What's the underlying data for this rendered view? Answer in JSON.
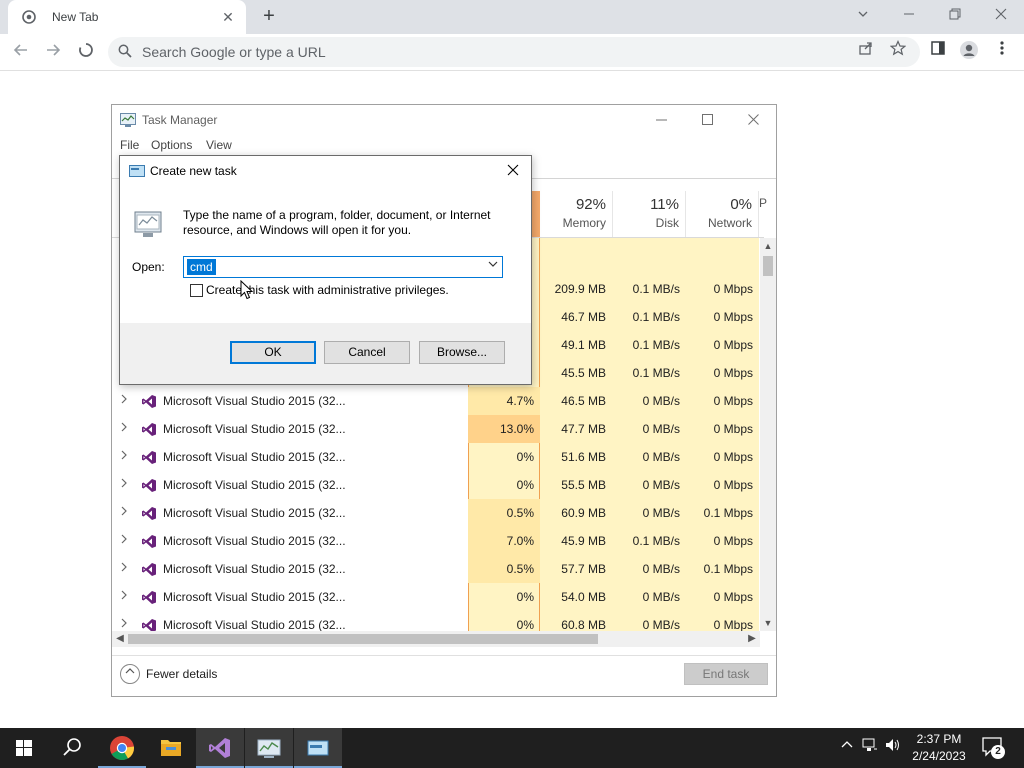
{
  "browser": {
    "tab_title": "New Tab",
    "tab_close": "✕",
    "new_tab": "+",
    "omnibox_placeholder": "Search Google or type a URL",
    "icons": [
      "chrome-favicon-icon",
      "back-arrow-icon",
      "forward-arrow-icon",
      "stop-loading-icon",
      "search-icon",
      "share-icon",
      "bookmark-star-icon",
      "side-panel-icon",
      "profile-icon",
      "menu-dots-icon",
      "tab-search-icon",
      "minimize-icon",
      "restore-icon",
      "close-icon"
    ]
  },
  "task_manager": {
    "title": "Task Manager",
    "menu": [
      "File",
      "Options",
      "View"
    ],
    "columns": [
      {
        "pct": "92%",
        "label": "Memory"
      },
      {
        "pct": "11%",
        "label": "Disk"
      },
      {
        "pct": "0%",
        "label": "Network"
      },
      {
        "pct": "",
        "label": "P"
      }
    ],
    "partial_rows": [
      {
        "mem": "209.9 MB",
        "disk": "0.1 MB/s",
        "net": "0 Mbps"
      },
      {
        "mem": "46.7 MB",
        "disk": "0.1 MB/s",
        "net": "0 Mbps"
      },
      {
        "mem": "49.1 MB",
        "disk": "0.1 MB/s",
        "net": "0 Mbps"
      },
      {
        "mem": "45.5 MB",
        "disk": "0.1 MB/s",
        "net": "0 Mbps"
      }
    ],
    "rows": [
      {
        "name": "Microsoft Visual Studio 2015 (32...",
        "cpu": "4.7%",
        "mem": "46.5 MB",
        "disk": "0 MB/s",
        "net": "0 Mbps",
        "heat": "warm"
      },
      {
        "name": "Microsoft Visual Studio 2015 (32...",
        "cpu": "13.0%",
        "mem": "47.7 MB",
        "disk": "0 MB/s",
        "net": "0 Mbps",
        "heat": "hot"
      },
      {
        "name": "Microsoft Visual Studio 2015 (32...",
        "cpu": "0%",
        "mem": "51.6 MB",
        "disk": "0 MB/s",
        "net": "0 Mbps",
        "heat": ""
      },
      {
        "name": "Microsoft Visual Studio 2015 (32...",
        "cpu": "0%",
        "mem": "55.5 MB",
        "disk": "0 MB/s",
        "net": "0 Mbps",
        "heat": ""
      },
      {
        "name": "Microsoft Visual Studio 2015 (32...",
        "cpu": "0.5%",
        "mem": "60.9 MB",
        "disk": "0 MB/s",
        "net": "0.1 Mbps",
        "heat": "warm"
      },
      {
        "name": "Microsoft Visual Studio 2015 (32...",
        "cpu": "7.0%",
        "mem": "45.9 MB",
        "disk": "0.1 MB/s",
        "net": "0 Mbps",
        "heat": "warm"
      },
      {
        "name": "Microsoft Visual Studio 2015 (32...",
        "cpu": "0.5%",
        "mem": "57.7 MB",
        "disk": "0 MB/s",
        "net": "0.1 Mbps",
        "heat": "warm"
      },
      {
        "name": "Microsoft Visual Studio 2015 (32...",
        "cpu": "0%",
        "mem": "54.0 MB",
        "disk": "0 MB/s",
        "net": "0 Mbps",
        "heat": ""
      },
      {
        "name": "Microsoft Visual Studio 2015 (32...",
        "cpu": "0%",
        "mem": "60.8 MB",
        "disk": "0 MB/s",
        "net": "0 Mbps",
        "heat": ""
      }
    ],
    "fewer_details": "Fewer details",
    "end_task": "End task"
  },
  "run_dialog": {
    "title": "Create new task",
    "description": "Type the name of a program, folder, document, or Internet resource, and Windows will open it for you.",
    "open_label": "Open:",
    "open_value": "cmd",
    "admin_label": "Create this task with administrative privileges.",
    "admin_checked": false,
    "ok": "OK",
    "cancel": "Cancel",
    "browse": "Browse..."
  },
  "taskbar": {
    "apps": [
      "windows-start-icon",
      "search-icon",
      "chrome-icon",
      "file-explorer-icon",
      "visual-studio-icon",
      "task-manager-icon",
      "run-dialog-icon"
    ],
    "time": "2:37 PM",
    "date": "2/24/2023",
    "notification_count": "2"
  },
  "colors": {
    "accent": "#0078d7",
    "cpu_heat_hot": "#ffd28a",
    "cpu_heat_warm": "#ffe9a8",
    "usage_bg": "#fff4c4",
    "vs_purple": "#68217a"
  }
}
